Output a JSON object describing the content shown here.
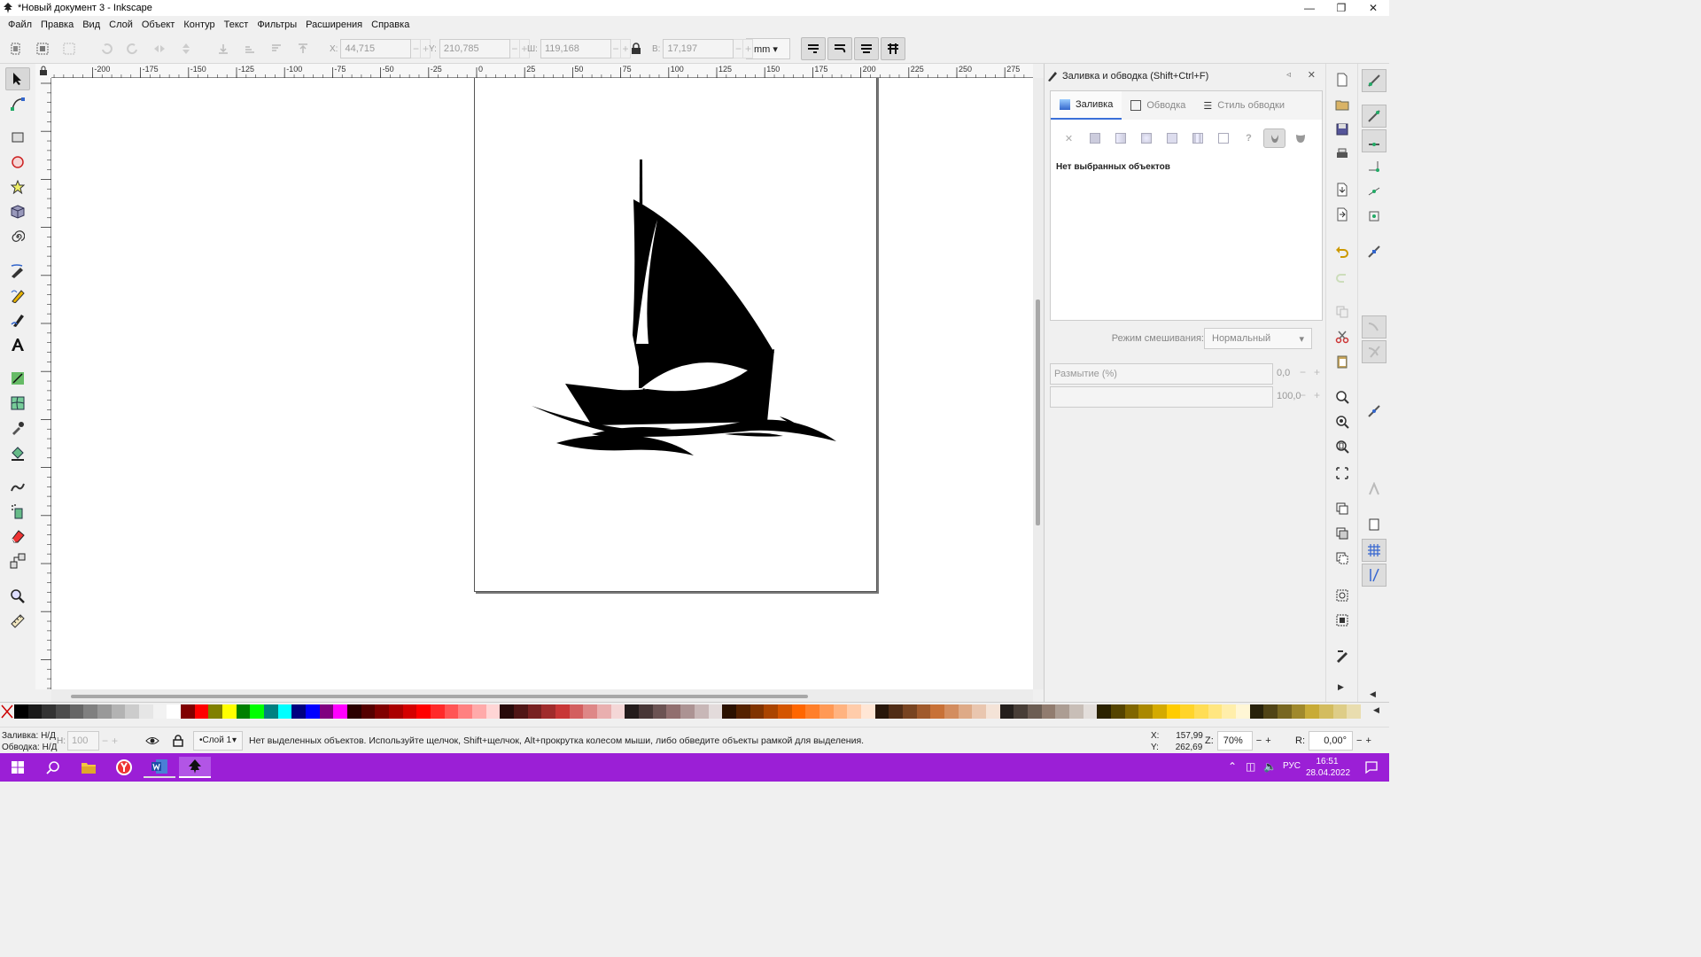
{
  "window": {
    "title": "*Новый документ 3 - Inkscape"
  },
  "menu": [
    "Файл",
    "Правка",
    "Вид",
    "Слой",
    "Объект",
    "Контур",
    "Текст",
    "Фильтры",
    "Расширения",
    "Справка"
  ],
  "toolbar": {
    "x_label": "X:",
    "x_value": "44,715",
    "y_label": "Y:",
    "y_value": "210,785",
    "w_label": "Ш:",
    "w_value": "119,168",
    "h_label": "В:",
    "h_value": "17,197",
    "unit": "mm"
  },
  "ruler": {
    "ticks": [
      "-200",
      "-175",
      "-150",
      "-125",
      "-100",
      "-75",
      "-50",
      "-25",
      "0",
      "25",
      "50",
      "75",
      "100",
      "125",
      "150",
      "175",
      "200",
      "225",
      "250",
      "275"
    ]
  },
  "dialog": {
    "title": "Заливка и обводка (Shift+Ctrl+F)",
    "tabs": [
      "Заливка",
      "Обводка",
      "Стиль обводки"
    ],
    "paint_question": "?",
    "no_selection": "Нет выбранных объектов",
    "blend_label": "Режим смешивания:",
    "blend_value": "Нормальный",
    "blur_label": "Размытие (%)",
    "blur_value": "0,0",
    "opacity_value": "100,0"
  },
  "statusbar": {
    "fill_label": "Заливка:",
    "fill_value": "Н/Д",
    "stroke_label": "Обводка:",
    "stroke_value": "Н/Д",
    "opacity_label": "Н:",
    "opacity_value": "100",
    "layer": "•Слой 1",
    "message": "Нет выделенных объектов. Используйте щелчок, Shift+щелчок, Alt+прокрутка колесом мыши, либо обведите объекты рамкой для выделения.",
    "x_label": "X:",
    "x_value": "157,99",
    "y_label": "Y:",
    "y_value": "262,69",
    "zoom_label": "Z:",
    "zoom_value": "70%",
    "rotate_label": "R:",
    "rotate_value": "0,00°"
  },
  "taskbar": {
    "lang": "РУС",
    "time": "16:51",
    "date": "28.04.2022"
  },
  "palette_colors": [
    "#000000",
    "#1a1a1a",
    "#333333",
    "#4d4d4d",
    "#666666",
    "#808080",
    "#999999",
    "#b3b3b3",
    "#cccccc",
    "#e6e6e6",
    "#f2f2f2",
    "#ffffff",
    "#800000",
    "#ff0000",
    "#808000",
    "#ffff00",
    "#008000",
    "#00ff00",
    "#008080",
    "#00ffff",
    "#000080",
    "#0000ff",
    "#800080",
    "#ff00ff",
    "#2b0000",
    "#550000",
    "#800000",
    "#aa0000",
    "#d40000",
    "#ff0000",
    "#ff2a2a",
    "#ff5555",
    "#ff8080",
    "#ffaaaa",
    "#ffd5d5",
    "#280b0b",
    "#501616",
    "#782121",
    "#a02c2c",
    "#c83737",
    "#d35f5f",
    "#de8787",
    "#e9afaf",
    "#f4d7d7",
    "#241c1c",
    "#483737",
    "#6c5353",
    "#916f6f",
    "#ac9393",
    "#c8b7b7",
    "#e3dbdb",
    "#2b1100",
    "#552200",
    "#803300",
    "#aa4400",
    "#d45500",
    "#ff6600",
    "#ff7f2a",
    "#ff9955",
    "#ffb380",
    "#ffccaa",
    "#ffe6d5",
    "#28170b",
    "#502d16",
    "#784421",
    "#a05a2c",
    "#c87137",
    "#d38d5f",
    "#deaa87",
    "#e9c6af",
    "#f4e3d7",
    "#241f1c",
    "#483e37",
    "#6c5d53",
    "#917c6f",
    "#ac9d93",
    "#c8beb7",
    "#e3dedb",
    "#2b2200",
    "#554400",
    "#806600",
    "#aa8800",
    "#d4aa00",
    "#ffcc00",
    "#ffd42a",
    "#ffdd55",
    "#ffe680",
    "#ffeeaa",
    "#fff6d5",
    "#28220b",
    "#504416",
    "#786721",
    "#a0892c",
    "#c8ab37",
    "#d3bc5f",
    "#decd87",
    "#e9ddaf"
  ]
}
